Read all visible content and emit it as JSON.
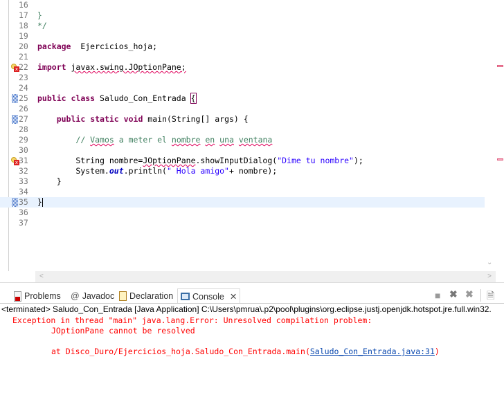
{
  "editor": {
    "lines": [
      {
        "n": "16",
        "tokens": []
      },
      {
        "n": "17",
        "tokens": [
          [
            "cm",
            "}"
          ]
        ]
      },
      {
        "n": "18",
        "tokens": [
          [
            "cm",
            "*/"
          ]
        ]
      },
      {
        "n": "19",
        "tokens": []
      },
      {
        "n": "20",
        "tokens": [
          [
            "kw",
            "package"
          ],
          [
            "",
            "  Ejercicios_hoja;"
          ]
        ]
      },
      {
        "n": "21",
        "tokens": []
      },
      {
        "n": "22",
        "marker": "error",
        "tokens": [
          [
            "kw",
            "import"
          ],
          [
            "",
            " "
          ],
          [
            "err",
            "javax.swing.JOptionPane;"
          ]
        ]
      },
      {
        "n": "23",
        "tokens": []
      },
      {
        "n": "24",
        "tokens": []
      },
      {
        "n": "25",
        "fold": true,
        "tokens": [
          [
            "kw",
            "public"
          ],
          [
            "",
            " "
          ],
          [
            "kw",
            "class"
          ],
          [
            "",
            " Saludo_Con_Entrada "
          ],
          [
            "brk",
            "{"
          ]
        ]
      },
      {
        "n": "26",
        "tokens": []
      },
      {
        "n": "27",
        "fold": true,
        "tokens": [
          [
            "",
            "    "
          ],
          [
            "kw",
            "public"
          ],
          [
            "",
            " "
          ],
          [
            "kw",
            "static"
          ],
          [
            "",
            " "
          ],
          [
            "kw",
            "void"
          ],
          [
            "",
            " main(String[] args) {"
          ]
        ]
      },
      {
        "n": "28",
        "tokens": []
      },
      {
        "n": "29",
        "tokens": [
          [
            "",
            "        "
          ],
          [
            "cm",
            "// "
          ],
          [
            "cm err",
            "Vamos"
          ],
          [
            "cm",
            " a meter el "
          ],
          [
            "cm err",
            "nombre"
          ],
          [
            "cm",
            " "
          ],
          [
            "cm err",
            "en"
          ],
          [
            "cm",
            " "
          ],
          [
            "cm err",
            "una"
          ],
          [
            "cm",
            " "
          ],
          [
            "cm err",
            "ventana"
          ]
        ]
      },
      {
        "n": "30",
        "tokens": []
      },
      {
        "n": "31",
        "marker": "error",
        "tokens": [
          [
            "",
            "        String nombre="
          ],
          [
            "err",
            "JOptionPane"
          ],
          [
            "",
            ".showInputDialog("
          ],
          [
            "str",
            "\"Dime tu nombre\""
          ],
          [
            "",
            ");"
          ]
        ]
      },
      {
        "n": "32",
        "tokens": [
          [
            "",
            "        System."
          ],
          [
            "fld",
            "out"
          ],
          [
            "",
            ".println("
          ],
          [
            "str",
            "\" Hola amigo\""
          ],
          [
            "",
            "+ nombre);"
          ]
        ]
      },
      {
        "n": "33",
        "tokens": [
          [
            "",
            "    }"
          ]
        ]
      },
      {
        "n": "34",
        "tokens": []
      },
      {
        "n": "35",
        "fold": true,
        "current": true,
        "tokens": [
          [
            "",
            "}"
          ]
        ]
      },
      {
        "n": "36",
        "tokens": []
      },
      {
        "n": "37",
        "tokens": []
      }
    ]
  },
  "panel": {
    "tabs": [
      {
        "label": "Problems",
        "icon": "problems-icon"
      },
      {
        "label": "Javadoc",
        "icon": "at-icon"
      },
      {
        "label": "Declaration",
        "icon": "declaration-icon"
      },
      {
        "label": "Console",
        "icon": "console-icon",
        "active": true
      }
    ],
    "console_header": "<terminated> Saludo_Con_Entrada [Java Application] C:\\Users\\pmrua\\.p2\\pool\\plugins\\org.eclipse.justj.openjdk.hotspot.jre.full.win32.",
    "output": {
      "line1": "Exception in thread \"main\" java.lang.Error: Unresolved compilation problem: ",
      "line2": "\tJOptionPane cannot be resolved",
      "line3_prefix": "\tat Disco_Duro/Ejercicios_hoja.Saludo_Con_Entrada.main(",
      "line3_link": "Saludo_Con_Entrada.java:31",
      "line3_suffix": ")"
    }
  },
  "colors": {
    "keyword": "#7f0055",
    "comment": "#3f7f5f",
    "string": "#2a00ff",
    "error": "#ff0000",
    "current_line": "#e8f2fe"
  }
}
